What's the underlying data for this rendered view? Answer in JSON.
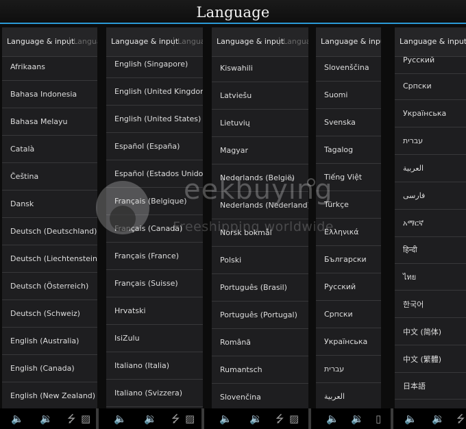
{
  "window": {
    "title": "Language",
    "accent_color": "#2b9bd8"
  },
  "panels": [
    {
      "header": "Language & input",
      "header_next": "Langua",
      "items": [
        "Afrikaans",
        "Bahasa Indonesia",
        "Bahasa Melayu",
        "Català",
        "Čeština",
        "Dansk",
        "Deutsch (Deutschland)",
        "Deutsch (Liechtenstein)",
        "Deutsch (Österreich)",
        "Deutsch (Schweiz)",
        "English (Australia)",
        "English (Canada)",
        "English (New Zealand)"
      ]
    },
    {
      "header": "Language & input",
      "header_next": "Langua",
      "items": [
        "English (Singapore)",
        "English (United Kingdom)",
        "English (United States)",
        "Español (España)",
        "Español (Estados Unidos)",
        "Français (Belgique)",
        "Français (Canada)",
        "Français (France)",
        "Français (Suisse)",
        "Hrvatski",
        "IsiZulu",
        "Italiano (Italia)",
        "Italiano (Svizzera)"
      ]
    },
    {
      "header": "Language & input",
      "header_next": "Langua",
      "items": [
        "Kiswahili",
        "Latviešu",
        "Lietuvių",
        "Magyar",
        "Nederlands (België)",
        "Nederlands (Nederland)",
        "Norsk bokmål",
        "Polski",
        "Português (Brasil)",
        "Português (Portugal)",
        "Română",
        "Rumantsch",
        "Slovenčina"
      ]
    },
    {
      "header": "Language & input",
      "header_next": "",
      "items": [
        "Slovenščina",
        "Suomi",
        "Svenska",
        "Tagalog",
        "Tiếng Việt",
        "Türkçe",
        "Ελληνικά",
        "Български",
        "Русский",
        "Српски",
        "Українська",
        "עברית",
        "العربية"
      ]
    },
    {
      "header": "Language & input",
      "header_next": "",
      "items": [
        "Русский",
        "Српски",
        "Українська",
        "עברית",
        "العربية",
        "فارسی",
        "አማርኛ",
        "हिन्दी",
        "ไทย",
        "한국어",
        "中文 (简体)",
        "中文 (繁體)",
        "日本語"
      ]
    }
  ],
  "watermark": {
    "brand": "eekbuying",
    "tagline": "Freeshipping worldwide"
  },
  "navbar": {
    "icons": [
      "volume-down-icon",
      "volume-up-icon",
      "usb-icon",
      "gallery-icon",
      "recent-apps-icon"
    ]
  }
}
